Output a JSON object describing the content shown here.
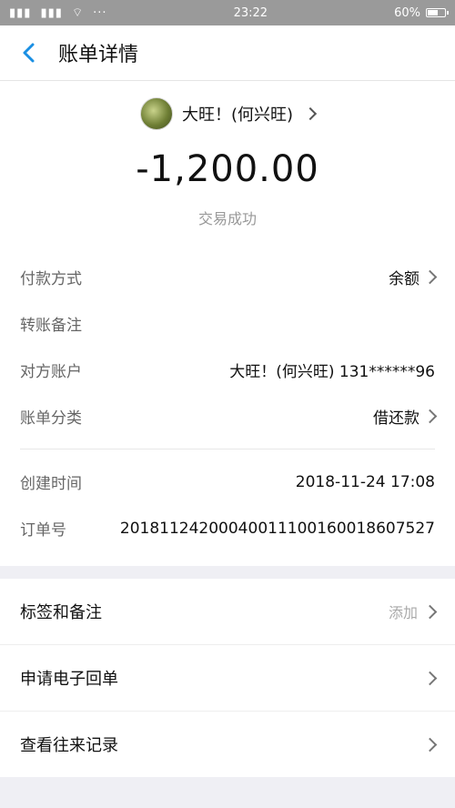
{
  "status_bar": {
    "time": "23:22",
    "battery": "60%"
  },
  "nav": {
    "title": "账单详情"
  },
  "header": {
    "payee": "大旺！(何兴旺)",
    "amount": "-1,200.00",
    "status": "交易成功"
  },
  "details": {
    "rows": [
      {
        "label": "付款方式",
        "value": "余额",
        "has_chevron": true
      },
      {
        "label": "转账备注",
        "value": ""
      },
      {
        "label": "对方账户",
        "value": "大旺！(何兴旺) 131******96"
      },
      {
        "label": "账单分类",
        "value": "借还款",
        "has_chevron": true
      }
    ],
    "meta": [
      {
        "label": "创建时间",
        "value": "2018-11-24 17:08"
      },
      {
        "label": "订单号",
        "value": "20181124200040011100160018607527"
      }
    ]
  },
  "actions": [
    {
      "label": "标签和备注",
      "right": "添加"
    },
    {
      "label": "申请电子回单",
      "right": ""
    },
    {
      "label": "查看往来记录",
      "right": ""
    }
  ],
  "icons": {
    "back": "back-chevron-icon",
    "chevron": "chevron-right-icon"
  }
}
